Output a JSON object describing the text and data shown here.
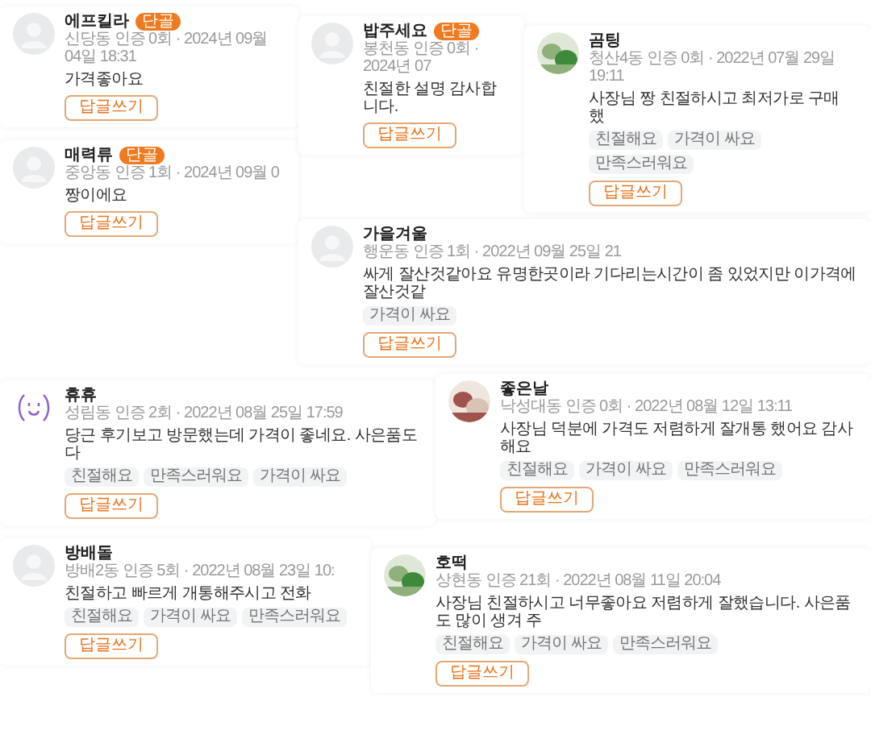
{
  "reviews": [
    {
      "name": "에프킬라",
      "badge": "단골",
      "meta": "신당동 인증 0회 · 2024년 09월 04일 18:31",
      "text": "가격좋아요",
      "reply_button": "답글쓰기",
      "avatar": {
        "kind": "default"
      }
    },
    {
      "name": "밥주세요",
      "badge": "단골",
      "meta": "봉천동 인증 0회 · 2024년 07",
      "text": "친절한 설명 감사합니다.",
      "reply_button": "답글쓰기",
      "avatar": {
        "kind": "default"
      }
    },
    {
      "name": "곰팅",
      "meta": "청산4동 인증 0회 · 2022년 07월 29일 19:11",
      "text": "사장님 짱 친절하시고 최저가로 구매 했",
      "tags": [
        "친절해요",
        "가격이 싸요",
        "만족스러워요"
      ],
      "reply_button": "답글쓰기"
    },
    {
      "name": "매력류",
      "badge": "단골",
      "meta": "중앙동 인증 1회 · 2024년 09월 0",
      "text": "짱이에요",
      "reply_button": "답글쓰기",
      "avatar": {
        "kind": "default"
      }
    },
    {
      "name": "가을겨울",
      "meta": "행운동 인증 1회 · 2022년 09월 25일 21",
      "text": "싸게 잘산것같아요 유명한곳이라 기다리는시간이 좀 있었지만 이가격에 잘산것같",
      "tags": [
        "가격이 싸요"
      ],
      "reply_button": "답글쓰기",
      "avatar": {
        "kind": "default"
      }
    },
    {
      "name": "휴휴",
      "meta": "성림동 인증 2회 · 2022년 08월 25일 17:59",
      "text": "당근 후기보고 방문했는데 가격이 좋네요. 사은품도 다",
      "tags": [
        "친절해요",
        "만족스러워요",
        "가격이 싸요"
      ],
      "reply_button": "답글쓰기",
      "avatar": {
        "kind": "doodle"
      }
    },
    {
      "name": "좋은날",
      "meta": "낙성대동 인증 0회 · 2022년 08월 12일 13:11",
      "text": "사장님 덕분에 가격도 저렴하게 잘개통 했어요 감사해요",
      "tags": [
        "친절해요",
        "가격이 싸요",
        "만족스러워요"
      ],
      "reply_button": "답글쓰기"
    },
    {
      "name": "방배돌",
      "meta": "방배2동 인증 5회 · 2022년 08월 23일 10:",
      "text": "친절하고 빠르게 개통해주시고 전화",
      "tags": [
        "친절해요",
        "가격이 싸요",
        "만족스러워요"
      ],
      "reply_button": "답글쓰기",
      "avatar": {
        "kind": "default"
      }
    },
    {
      "name": "호떡",
      "meta": "상현동 인증 21회 · 2022년 08월 11일 20:04",
      "text": "사장님 친절하시고 너무좋아요 저렴하게 잘했습니다. 사은품도 많이 생겨 주",
      "tags": [
        "친절해요",
        "가격이 싸요",
        "만족스러워요"
      ],
      "reply_button": "답글쓰기"
    }
  ]
}
